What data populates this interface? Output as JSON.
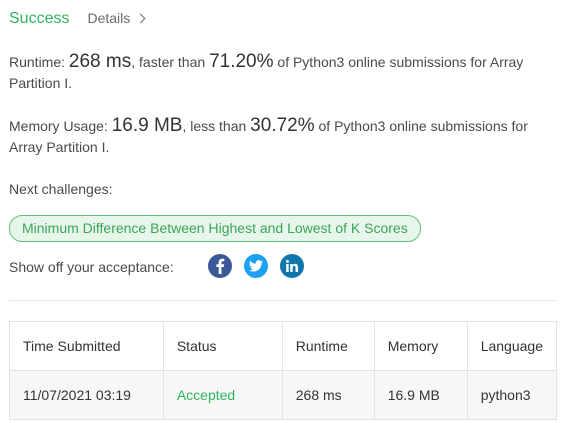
{
  "header": {
    "status": "Success",
    "details_label": "Details"
  },
  "runtime": {
    "label": "Runtime:",
    "value": "268 ms",
    "comparison": ", faster than ",
    "percent": "71.20%",
    "tail": " of Python3 online submissions for Array Partition I."
  },
  "memory": {
    "label": "Memory Usage:",
    "value": "16.9 MB",
    "comparison": ", less than ",
    "percent": "30.72%",
    "tail": " of Python3 online submissions for Array Partition I."
  },
  "next": {
    "label": "Next challenges:",
    "challenge": "Minimum Difference Between Highest and Lowest of K Scores"
  },
  "share": {
    "label": "Show off your acceptance:",
    "icons": [
      "facebook-icon",
      "twitter-icon",
      "linkedin-icon"
    ]
  },
  "table": {
    "headers": [
      "Time Submitted",
      "Status",
      "Runtime",
      "Memory",
      "Language"
    ],
    "rows": [
      {
        "time": "11/07/2021 03:19",
        "status": "Accepted",
        "runtime": "268 ms",
        "memory": "16.9 MB",
        "language": "python3"
      }
    ]
  },
  "colors": {
    "success": "#2db55d",
    "pill_bg": "#e7f6ea",
    "facebook": "#3b5998",
    "twitter": "#1da1f2",
    "linkedin": "#0e76a8"
  }
}
